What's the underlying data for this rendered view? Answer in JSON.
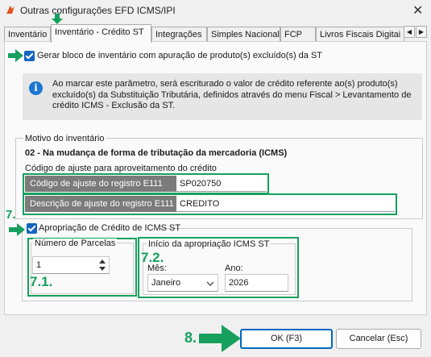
{
  "window": {
    "title": "Outras configurações EFD ICMS/IPI",
    "close_glyph": "✕"
  },
  "tabs": [
    {
      "label": "Inventário"
    },
    {
      "label": "Inventário - Crédito ST"
    },
    {
      "label": "Integrações"
    },
    {
      "label": "Simples Nacional"
    },
    {
      "label": "FCP"
    },
    {
      "label": "Livros Fiscais Digitai"
    }
  ],
  "tab_scroll": {
    "left": "◀",
    "right": "▶"
  },
  "generate_block": {
    "label": "Gerar bloco de inventário com apuração de produto(s) excluído(s) da ST",
    "checked": true
  },
  "info": {
    "icon": "i",
    "text": "Ao marcar este parâmetro, será escriturado o valor de crédito referente ao(s) produto(s) excluído(s) da Substituição Tributária, definidos através do menu Fiscal > Levantamento de crédito ICMS - Exclusão da ST."
  },
  "reason": {
    "legend": "Motivo do inventário",
    "value": "02 - Na mudança de forma de tributação da mercadoria (ICMS)",
    "adjust_title": "Código de ajuste para aproveitamento do crédito",
    "code_label": "Código de ajuste do registro E111",
    "code_value": "SP020750",
    "desc_label": "Descrição de ajuste do registro E111",
    "desc_value": "CREDITO"
  },
  "appropriation": {
    "label": "Apropriação de Crédito de ICMS ST",
    "checked": true,
    "installments_legend": "Número de Parcelas",
    "installments_value": "1",
    "start_legend": "Início da apropriação ICMS ST",
    "month_label": "Mês:",
    "month_value": "Janeiro",
    "year_label": "Ano:",
    "year_value": "2026"
  },
  "buttons": {
    "ok": "OK (F3)",
    "cancel": "Cancelar (Esc)"
  },
  "annotations": {
    "step7": "7.",
    "step71": "7.1.",
    "step72": "7.2.",
    "step8": "8.",
    "color": "#17a05d"
  }
}
